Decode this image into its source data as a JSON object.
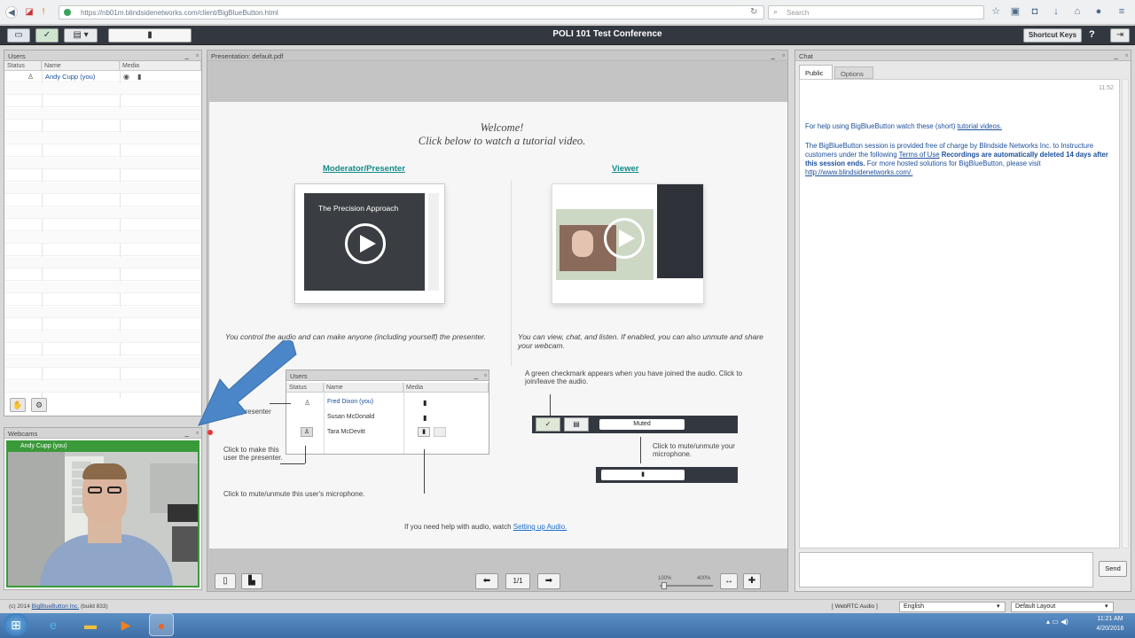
{
  "browser": {
    "url": "https://nb01m.blindsidenetworks.com/client/BigBlueButton.html",
    "search_placeholder": "Search"
  },
  "app": {
    "title": "POLI 101 Test Conference",
    "shortcut_keys": "Shortcut Keys",
    "help": "?"
  },
  "users": {
    "title": "Users",
    "columns": [
      "Status",
      "Name",
      "Media"
    ],
    "rows": [
      {
        "name": "Andy Cupp (you)"
      }
    ]
  },
  "webcams": {
    "title": "Webcams",
    "user_label": "Andy Cupp (you)"
  },
  "presentation": {
    "title": "Presentation: default.pdf",
    "welcome": "Welcome!",
    "welcome_sub": "Click below to watch a tutorial video.",
    "moderator_heading": "Moderator/Presenter",
    "viewer_heading": "Viewer",
    "video_title": "The Precision Approach",
    "moderator_text": "You control the audio and can make anyone (including yourself) the presenter.",
    "viewer_text": "You can view, chat, and listen.  If enabled, you can also unmute and share your webcam.",
    "mini_users": {
      "title": "Users",
      "columns": [
        "Status",
        "Name",
        "Media"
      ],
      "rows": [
        "Fred Dixon (you)",
        "Susan McDonald",
        "Tara McDevitt"
      ]
    },
    "callout_presenter": "presenter",
    "callout_make_presenter": "Click to make this user the presenter.",
    "callout_mute_user": "Click to mute/unmute this user's microphone.",
    "green_check_text": "A green checkmark appears when you have joined the audio.  Click to join/leave the audio.",
    "muted_label": "Muted",
    "mute_mic_text": "Click to mute/unmute your microphone.",
    "help_audio_prefix": "If you need help with audio, watch",
    "help_audio_link": "Setting up Audio.",
    "page_indicator": "1/1",
    "zoom_min": "100%",
    "zoom_max": "400%"
  },
  "chat": {
    "title": "Chat",
    "tabs": [
      "Public",
      "Options"
    ],
    "time": "11:52",
    "help_prefix": "For help using BigBlueButton watch these (short)",
    "help_link": "tutorial videos.",
    "session_prefix": "The BigBlueButton session is provided free of charge by Blindside Networks Inc. to Instructure customers under the following",
    "terms_link": "Terms of Use",
    "session_bold": "Recordings are automatically deleted 14 days after this session ends.",
    "session_suffix": "For more hosted solutions for BigBlueButton, please visit",
    "site_link": "http://www.blindsidenetworks.com/.",
    "send": "Send"
  },
  "footer": {
    "copyright": "(c) 2014",
    "copyright_link": "BigBlueButton Inc.",
    "build": "(build 833)",
    "webrtc": "[ WebRTC Audio ]",
    "language": "English",
    "layout": "Default Layout"
  },
  "taskbar": {
    "time": "11:21 AM",
    "date": "4/20/2016"
  },
  "colors": {
    "toolbar_dark": "#333840",
    "link_blue": "#1b4f9c",
    "teal": "#138a8a",
    "annotation_arrow": "#4a86c8",
    "webcam_green": "#3a9a3a",
    "taskbar_blue": "#4a7fb5"
  }
}
